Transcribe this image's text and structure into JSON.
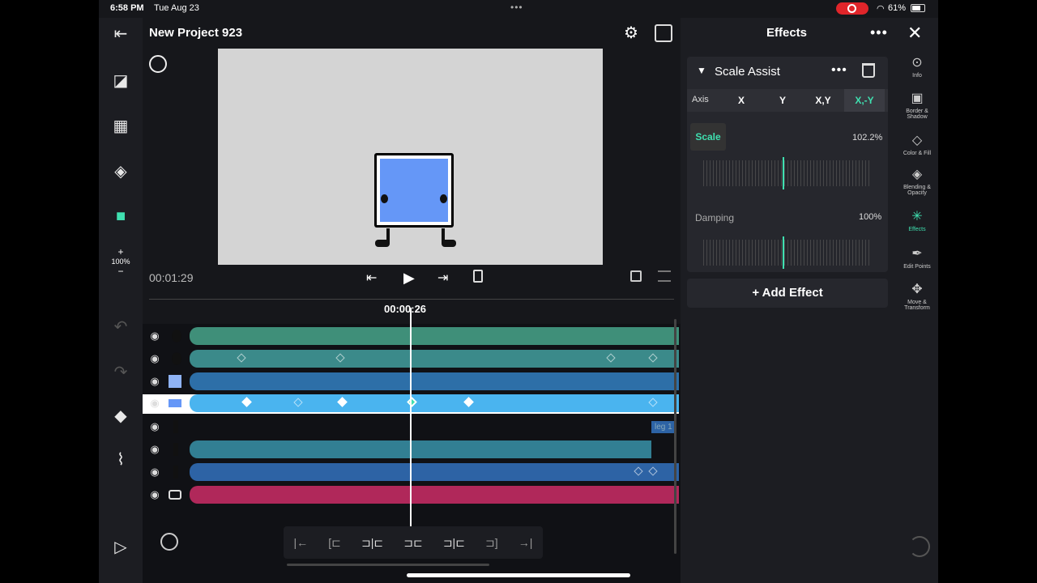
{
  "status": {
    "time": "6:58 PM",
    "date": "Tue Aug 23",
    "dots": "•••",
    "battery": "61%"
  },
  "header": {
    "title": "New Project 923"
  },
  "sidebar": {
    "zoom_plus": "+",
    "zoom_level": "100%",
    "zoom_minus": "−"
  },
  "transport": {
    "current_time": "00:01:29",
    "playhead_time": "00:00:26"
  },
  "timeline": {
    "label_leg": "leg 1",
    "tracks": [
      {
        "color": "#3f8f79",
        "thumb": "circle"
      },
      {
        "color": "#3b8a8a",
        "thumb": "circle"
      },
      {
        "color": "#2d6fa8",
        "thumb": "square"
      },
      {
        "color": "#4ab4ef",
        "thumb": "square-small",
        "selected": true
      },
      {
        "color": "#101115",
        "thumb": "stroke"
      },
      {
        "color": "#327f93",
        "thumb": "stroke"
      },
      {
        "color": "#2d63a5",
        "thumb": "stroke"
      },
      {
        "color": "#b0285a",
        "thumb": "camera"
      }
    ]
  },
  "panel": {
    "title": "Effects",
    "effect_name": "Scale Assist",
    "axis_label": "Axis",
    "axis_options": [
      "X",
      "Y",
      "X,Y",
      "X,-Y"
    ],
    "axis_selected": "X,-Y",
    "scale_label": "Scale",
    "scale_value": "102.2%",
    "damping_label": "Damping",
    "damping_value": "100%",
    "add_effect": "+ Add Effect"
  },
  "rail": [
    {
      "label": "Info",
      "icon": "info-icon"
    },
    {
      "label": "Border & Shadow",
      "icon": "border-icon"
    },
    {
      "label": "Color & Fill",
      "icon": "fill-icon"
    },
    {
      "label": "Blending & Opacity",
      "icon": "layers-icon"
    },
    {
      "label": "Effects",
      "icon": "effects-icon"
    },
    {
      "label": "Edit Points",
      "icon": "pen-icon"
    },
    {
      "label": "Move & Transform",
      "icon": "move-icon"
    }
  ],
  "colors": {
    "accent": "#3fe0b0",
    "stage": "#d4d4d4",
    "character": "#6597f7"
  }
}
